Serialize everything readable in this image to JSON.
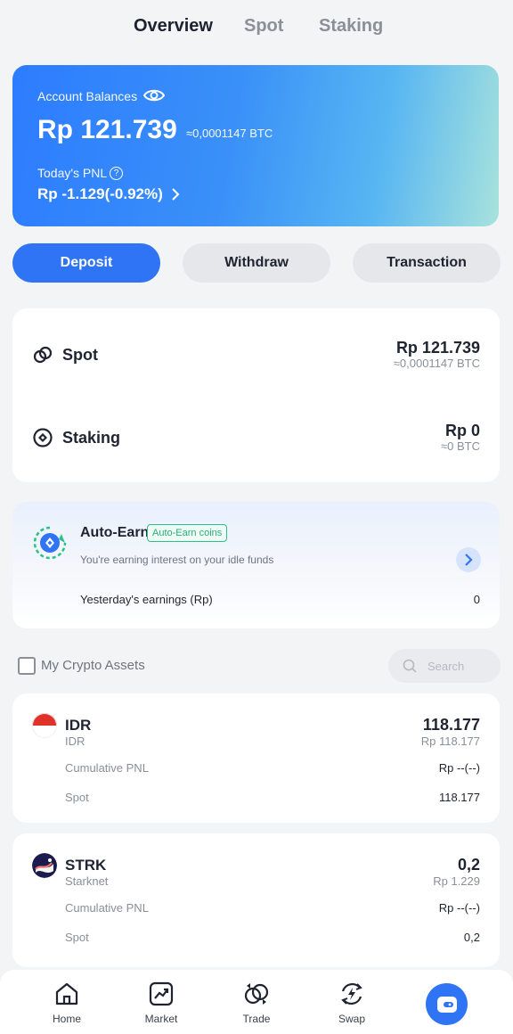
{
  "tabs": [
    {
      "label": "Overview",
      "active": true
    },
    {
      "label": "Spot",
      "active": false
    },
    {
      "label": "Staking",
      "active": false
    }
  ],
  "balance": {
    "label": "Account Balances",
    "amount": "Rp 121.739",
    "btc": "≈0,0001147 BTC",
    "pnl_label": "Today's PNL",
    "pnl_value": "Rp -1.129(-0.92%)"
  },
  "actions": {
    "deposit": "Deposit",
    "withdraw": "Withdraw",
    "transaction": "Transaction"
  },
  "accounts": [
    {
      "name": "Spot",
      "amount": "Rp 121.739",
      "btc": "≈0,0001147 BTC"
    },
    {
      "name": "Staking",
      "amount": "Rp 0",
      "btc": "≈0 BTC"
    }
  ],
  "auto_earn": {
    "title": "Auto-Earn",
    "badge": "Auto-Earn coins",
    "subtitle": "You're earning interest on your idle funds",
    "yesterday_label": "Yesterday's earnings (Rp)",
    "yesterday_value": "0"
  },
  "assets_header": {
    "label": "My Crypto Assets",
    "search_placeholder": "Search"
  },
  "assets": [
    {
      "symbol": "IDR",
      "name": "IDR",
      "amount": "118.177",
      "fiat": "Rp 118.177",
      "pnl_label": "Cumulative PNL",
      "pnl_value": "Rp --(--)",
      "spot_label": "Spot",
      "spot_value": "118.177"
    },
    {
      "symbol": "STRK",
      "name": "Starknet",
      "amount": "0,2",
      "fiat": "Rp 1.229",
      "pnl_label": "Cumulative PNL",
      "pnl_value": "Rp --(--)",
      "spot_label": "Spot",
      "spot_value": "0,2"
    }
  ],
  "nav": {
    "home": "Home",
    "market": "Market",
    "trade": "Trade",
    "swap": "Swap"
  },
  "colors": {
    "accent": "#2f74f5",
    "earn_badge": "#22b07c",
    "idr_red": "#e0312b"
  }
}
